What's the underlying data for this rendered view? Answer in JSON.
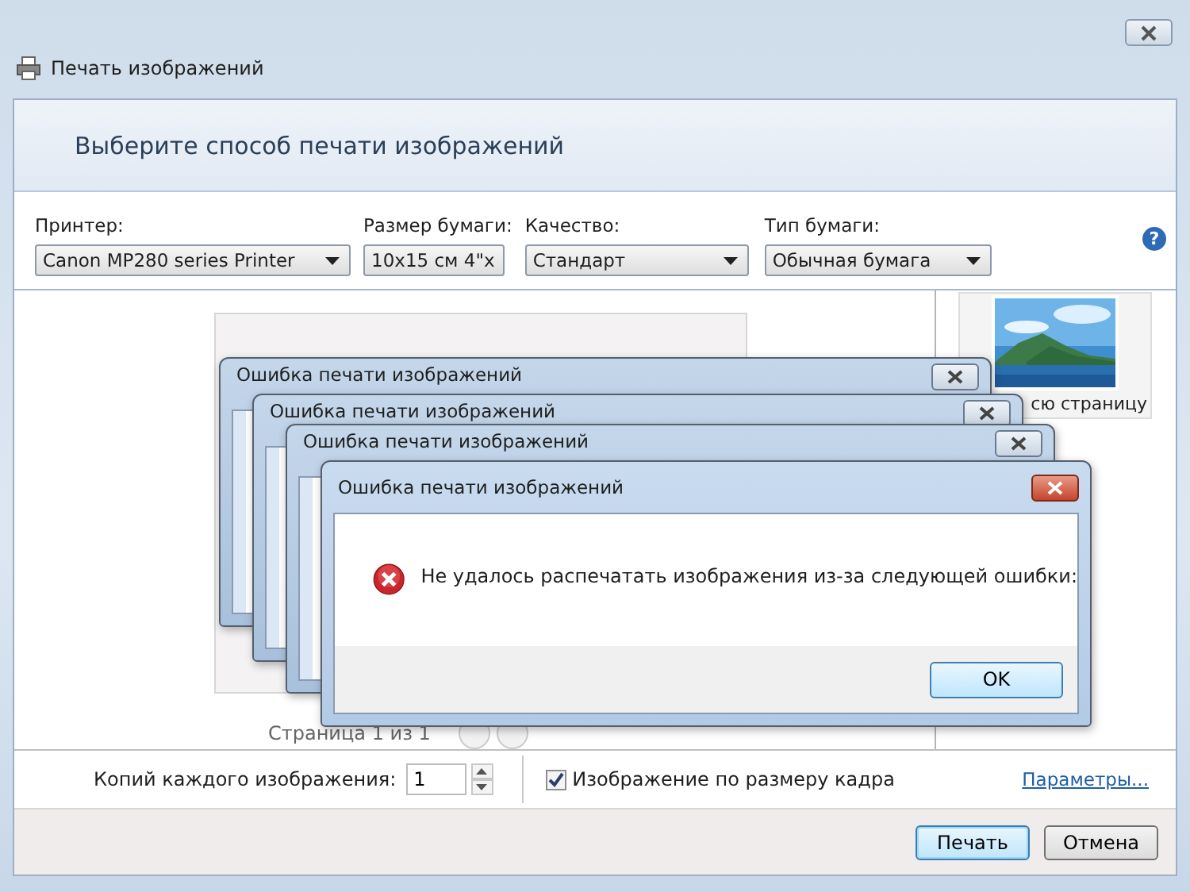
{
  "window": {
    "title": "Печать изображений",
    "heading": "Выберите способ печати изображений"
  },
  "options": [
    {
      "label": "Принтер:",
      "value": "Canon MP280 series Printer"
    },
    {
      "label": "Размер бумаги:",
      "value": "10x15 см 4\"x"
    },
    {
      "label": "Качество:",
      "value": "Стандарт"
    },
    {
      "label": "Тип бумаги:",
      "value": "Обычная бумага"
    }
  ],
  "help": "?",
  "preview": {
    "page_label": "Страница 1 из 1"
  },
  "layouts": [
    {
      "label": "сю страницу",
      "kind": "picture"
    }
  ],
  "copies": {
    "label": "Копий каждого изображения:",
    "value": "1"
  },
  "fit": {
    "label": "Изображение по размеру кадра",
    "checked": true
  },
  "link": "Параметры...",
  "buttons": [
    {
      "label": "Печать",
      "default": true
    },
    {
      "label": "Отмена",
      "default": false
    }
  ],
  "error_dialogs": [
    {
      "title": "Ошибка печати изображений",
      "active": false
    },
    {
      "title": "Ошибка печати изображений",
      "active": false
    },
    {
      "title": "Ошибка печати изображений",
      "active": false
    },
    {
      "title": "Ошибка печати изображений",
      "active": true,
      "message": "Не удалось распечатать изображения из-за следующей ошибки:",
      "button": "OK"
    }
  ]
}
